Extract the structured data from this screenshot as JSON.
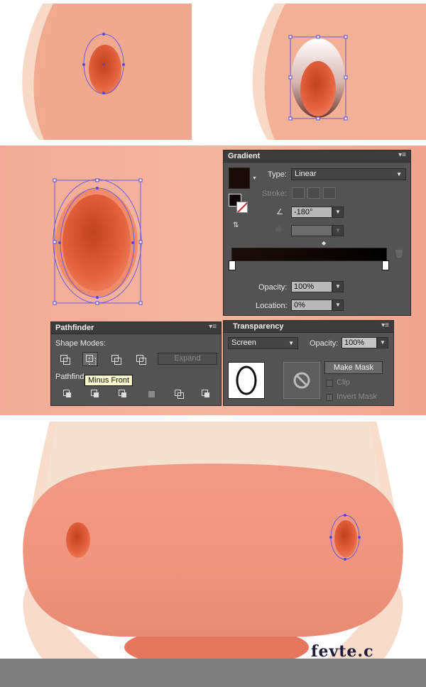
{
  "gradient_panel": {
    "title": "Gradient",
    "type_label": "Type:",
    "type_value": "Linear",
    "stroke_label": "Stroke:",
    "angle_value": "-180°",
    "opacity_label": "Opacity:",
    "opacity_value": "100%",
    "location_label": "Location:",
    "location_value": "0%"
  },
  "pathfinder_panel": {
    "title": "Pathfinder",
    "shape_modes_label": "Shape Modes:",
    "pathfinders_label": "Pathfind",
    "expand_label": "Expand",
    "tooltip": "Minus Front"
  },
  "transparency_panel": {
    "title": "Transparency",
    "blend_mode": "Screen",
    "opacity_label": "Opacity:",
    "opacity_value": "100%",
    "make_mask_label": "Make Mask",
    "clip_label": "Clip",
    "invert_mask_label": "Invert Mask"
  },
  "watermark": "fevte.c"
}
